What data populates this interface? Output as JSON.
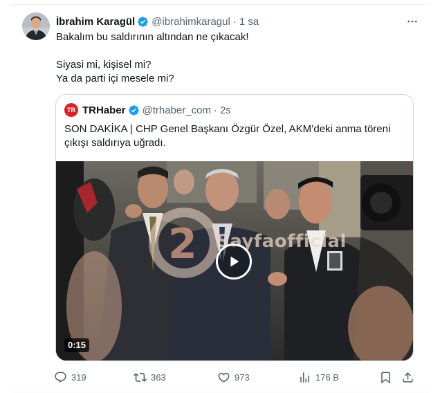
{
  "tweet": {
    "author": {
      "name": "İbrahim Karagül",
      "handle": "@ibrahimkaragul",
      "time": "1 sa",
      "verified": true
    },
    "text_lines": [
      "Bakalım bu saldırının altından ne çıkacak!",
      "Siyasi mi, kişisel mi?",
      "Ya da parti içi mesele mi?"
    ],
    "more_icon": "more-horizontal-icon"
  },
  "quote": {
    "logo_text": "TR",
    "name": "TRHaber",
    "handle": "@trhaber_com",
    "time": "2s",
    "verified": true,
    "text": "SON DAKİKA | CHP Genel Başkanı Özgür Özel, AKM’deki anma töreni çıkışı saldırıya uğradı.",
    "video": {
      "duration": "0:15",
      "watermark": "Sayfaofficial",
      "play_icon": "play-icon"
    }
  },
  "actions": {
    "reply_count": "319",
    "repost_count": "363",
    "like_count": "973",
    "views_count": "176 B"
  },
  "colors": {
    "verified_blue": "#1d9bf0",
    "secondary_text": "#536471",
    "border": "#cfd9de",
    "trhaber_red": "#d8232a"
  }
}
